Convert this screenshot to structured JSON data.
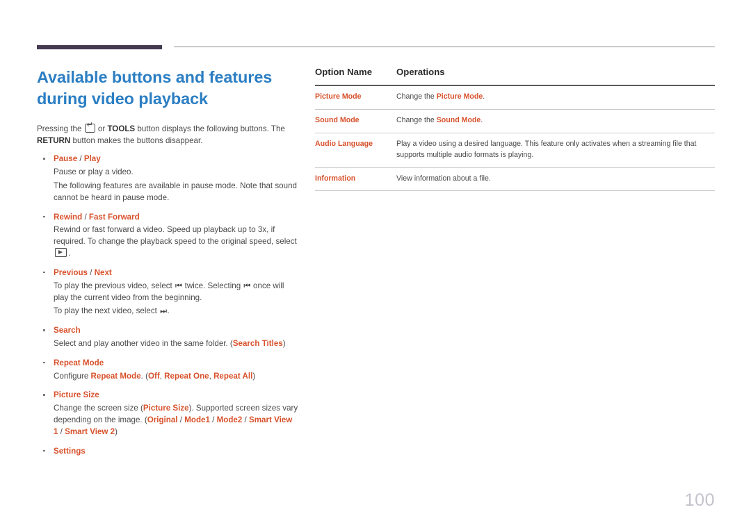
{
  "page": {
    "number": "100",
    "title": "Available buttons and features during video playback",
    "title_line1": "Available buttons and features",
    "title_line2": "during video playback"
  },
  "colors": {
    "heading_blue": "#2b7ec3",
    "accent_orange": "#d8512b",
    "rule_dark_purple": "#433a50",
    "body_gray": "#4a4a4a",
    "page_number_gray": "#c3c3cc"
  },
  "intro": {
    "part1": "Pressing the ",
    "icon_enter": "enter-key-icon",
    "part2": " or ",
    "bold_tools": "TOOLS",
    "part3": " button displays the following buttons. The ",
    "bold_return": "RETURN",
    "part4": " button makes the buttons disappear."
  },
  "bullets": [
    {
      "title_main": "Pause",
      "title_sep": " / ",
      "title_alt": "Play",
      "lines": [
        "Pause or play a video.",
        "The following features are available in pause mode. Note that sound cannot be heard in pause mode."
      ]
    },
    {
      "title_main": "Rewind",
      "title_sep": " / ",
      "title_alt": "Fast Forward",
      "line_part1": "Rewind or fast forward a video. Speed up playback up to 3x, if required. To change the playback speed to the original speed, select ",
      "icon_play": "play-button-icon",
      "line_part2": "."
    },
    {
      "title_main": "Previous",
      "title_sep": " / ",
      "title_alt": "Next",
      "line1_part1": "To play the previous video, select ",
      "icon_prev": "previous-track-icon",
      "line1_part2": " twice. Selecting ",
      "icon_prev2": "previous-track-icon",
      "line1_part3": " once will play the current video from the beginning.",
      "line2_part1": "To play the next video, select ",
      "icon_next": "next-track-icon",
      "line2_part2": "."
    },
    {
      "title_main": "Search",
      "line_part1": "Select and play another video in the same folder. (",
      "accent1": "Search Titles",
      "line_part2": ")"
    },
    {
      "title_main": "Repeat Mode",
      "line_part1": "Configure ",
      "accent1": "Repeat Mode",
      "line_part2": ". (",
      "accent2": "Off",
      "line_part3": ", ",
      "accent3": "Repeat One",
      "line_part4": ", ",
      "accent4": "Repeat All",
      "line_part5": ")"
    },
    {
      "title_main": "Picture Size",
      "line_part1": "Change the screen size (",
      "accent1": "Picture Size",
      "line_part2": "). Supported screen sizes vary depending on the image. (",
      "accent2": "Original",
      "sep1": " / ",
      "accent3": "Mode1",
      "sep2": " / ",
      "accent4": "Mode2",
      "sep3": " / ",
      "accent5": "Smart View 1",
      "sep4": " / ",
      "accent6": "Smart View 2",
      "line_part3": ")"
    },
    {
      "title_main": "Settings"
    }
  ],
  "table": {
    "headers": [
      "Option Name",
      "Operations"
    ],
    "rows": [
      {
        "name": "Picture Mode",
        "op_part1": "Change the ",
        "op_accent": "Picture Mode",
        "op_part2": "."
      },
      {
        "name": "Sound Mode",
        "op_part1": "Change the ",
        "op_accent": "Sound Mode",
        "op_part2": "."
      },
      {
        "name": "Audio Language",
        "op_part1": "Play a video using a desired language. This feature only activates when a streaming file that supports multiple audio formats is playing.",
        "op_accent": "",
        "op_part2": ""
      },
      {
        "name": "Information",
        "op_part1": "View information about a file.",
        "op_accent": "",
        "op_part2": ""
      }
    ]
  }
}
